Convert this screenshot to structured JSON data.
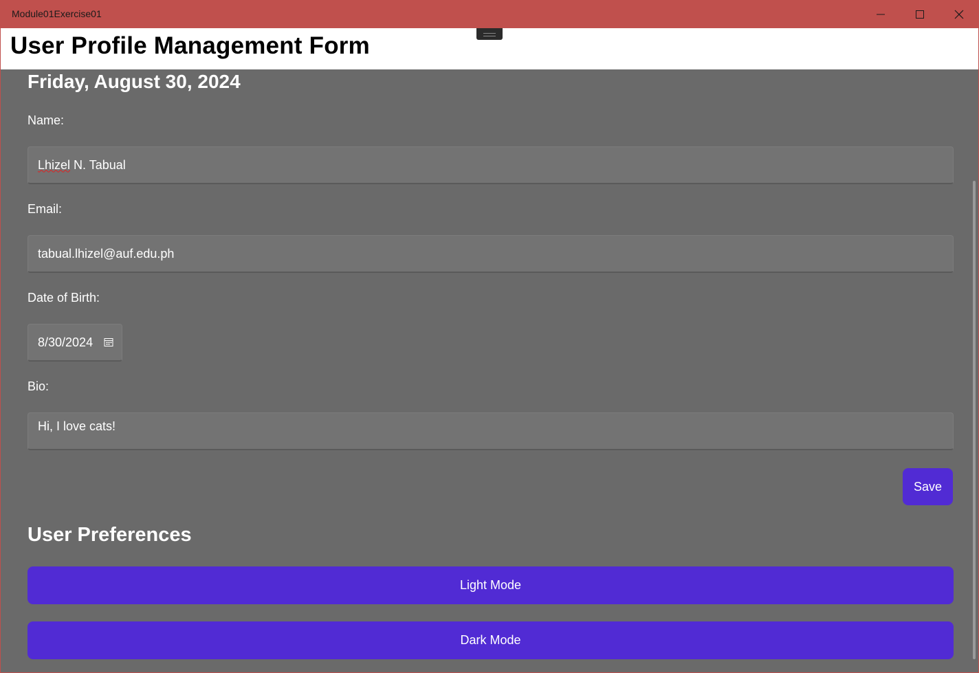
{
  "window": {
    "title": "Module01Exercise01",
    "accent": "#c0504d",
    "controls": [
      "minimize-icon",
      "maximize-icon",
      "close-icon"
    ]
  },
  "header": {
    "title": "User Profile Management Form"
  },
  "form": {
    "date_heading": "Friday, August 30, 2024",
    "name": {
      "label": "Name:",
      "value_first": "Lhizel",
      "value_rest": " N. Tabual"
    },
    "email": {
      "label": "Email:",
      "value": "tabual.lhizel@auf.edu.ph"
    },
    "dob": {
      "label": "Date of Birth:",
      "value": "8/30/2024",
      "icon": "calendar-icon"
    },
    "bio": {
      "label": "Bio:",
      "value": "Hi, I love cats!"
    },
    "save_label": "Save"
  },
  "preferences": {
    "title": "User Preferences",
    "light_label": "Light Mode",
    "dark_label": "Dark Mode"
  },
  "colors": {
    "button": "#512bd4",
    "background": "#6a6a6a"
  }
}
